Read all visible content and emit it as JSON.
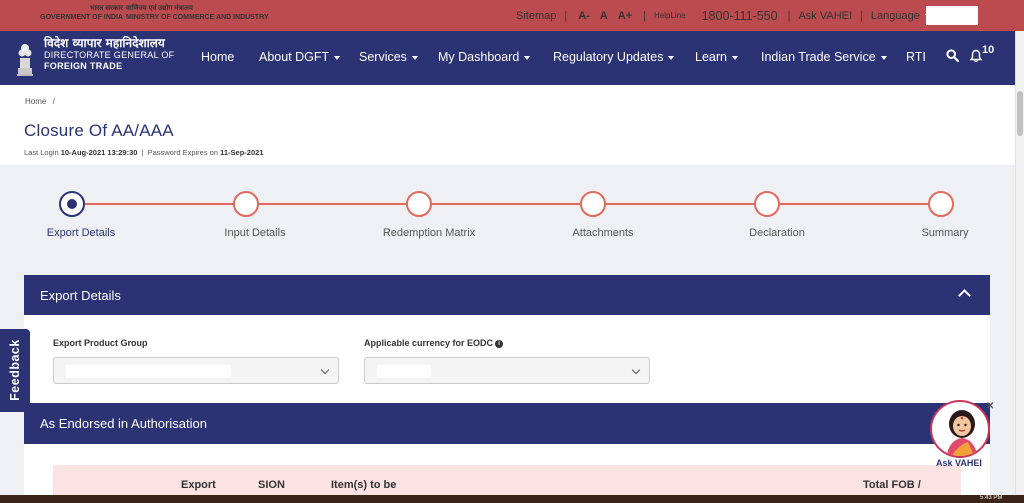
{
  "topbar": {
    "gov_hi": "भारत सरकार",
    "gov_en": "GOVERNMENT OF INDIA",
    "ministry_hi": "वाणिज्य एवं उद्योग मंत्रालय",
    "ministry_en": "MINISTRY OF COMMERCE AND INDUSTRY",
    "sitemap": "Sitemap",
    "font_small": "A-",
    "font_normal": "A",
    "font_large": "A+",
    "helpline_label": "HelpLine",
    "helpline_number": "1800-111-550",
    "ask_vahei": "Ask VAHEI",
    "language": "Language",
    "separator": "|"
  },
  "brand": {
    "hindi": "विदेश व्यापार महानिदेशालय",
    "line1": "DIRECTORATE GENERAL OF",
    "line2": "FOREIGN TRADE"
  },
  "nav": {
    "items": [
      {
        "label": "Home"
      },
      {
        "label": "About DGFT"
      },
      {
        "label": "Services"
      },
      {
        "label": "My Dashboard"
      },
      {
        "label": "Regulatory Updates"
      },
      {
        "label": "Learn"
      },
      {
        "label": "Indian Trade Service"
      },
      {
        "label": "RTI"
      }
    ],
    "notification_count": "10"
  },
  "page": {
    "breadcrumb_home": "Home",
    "breadcrumb_sep": "/",
    "title": "Closure Of AA/AAA",
    "last_login_label": "Last Login",
    "last_login_value": "10-Aug-2021 13:29:30",
    "pipe": "|",
    "password_label": "Password Expires on",
    "password_value": "11-Sep-2021"
  },
  "steps": [
    {
      "label": "Export Details",
      "active": true
    },
    {
      "label": "Input Details",
      "active": false
    },
    {
      "label": "Redemption Matrix",
      "active": false
    },
    {
      "label": "Attachments",
      "active": false
    },
    {
      "label": "Declaration",
      "active": false
    },
    {
      "label": "Summary",
      "active": false
    }
  ],
  "export_details": {
    "title": "Export Details",
    "product_group_label": "Export Product Group",
    "currency_label": "Applicable currency for EODC",
    "info_glyph": "i"
  },
  "endorsed": {
    "title": "As Endorsed in Authorisation",
    "columns": [
      "Export",
      "SION",
      "Item(s) to be",
      "Total FOB /"
    ]
  },
  "feedback_label": "Feedback",
  "vahei_label": "Ask VAHEI",
  "vahei_close": "✕",
  "clock": "5:43 PM",
  "colors": {
    "top_bar": "#bc4b4f",
    "nav_bar": "#2b3375",
    "step_accent": "#e26a5c",
    "table_header": "#fbe3e3"
  }
}
